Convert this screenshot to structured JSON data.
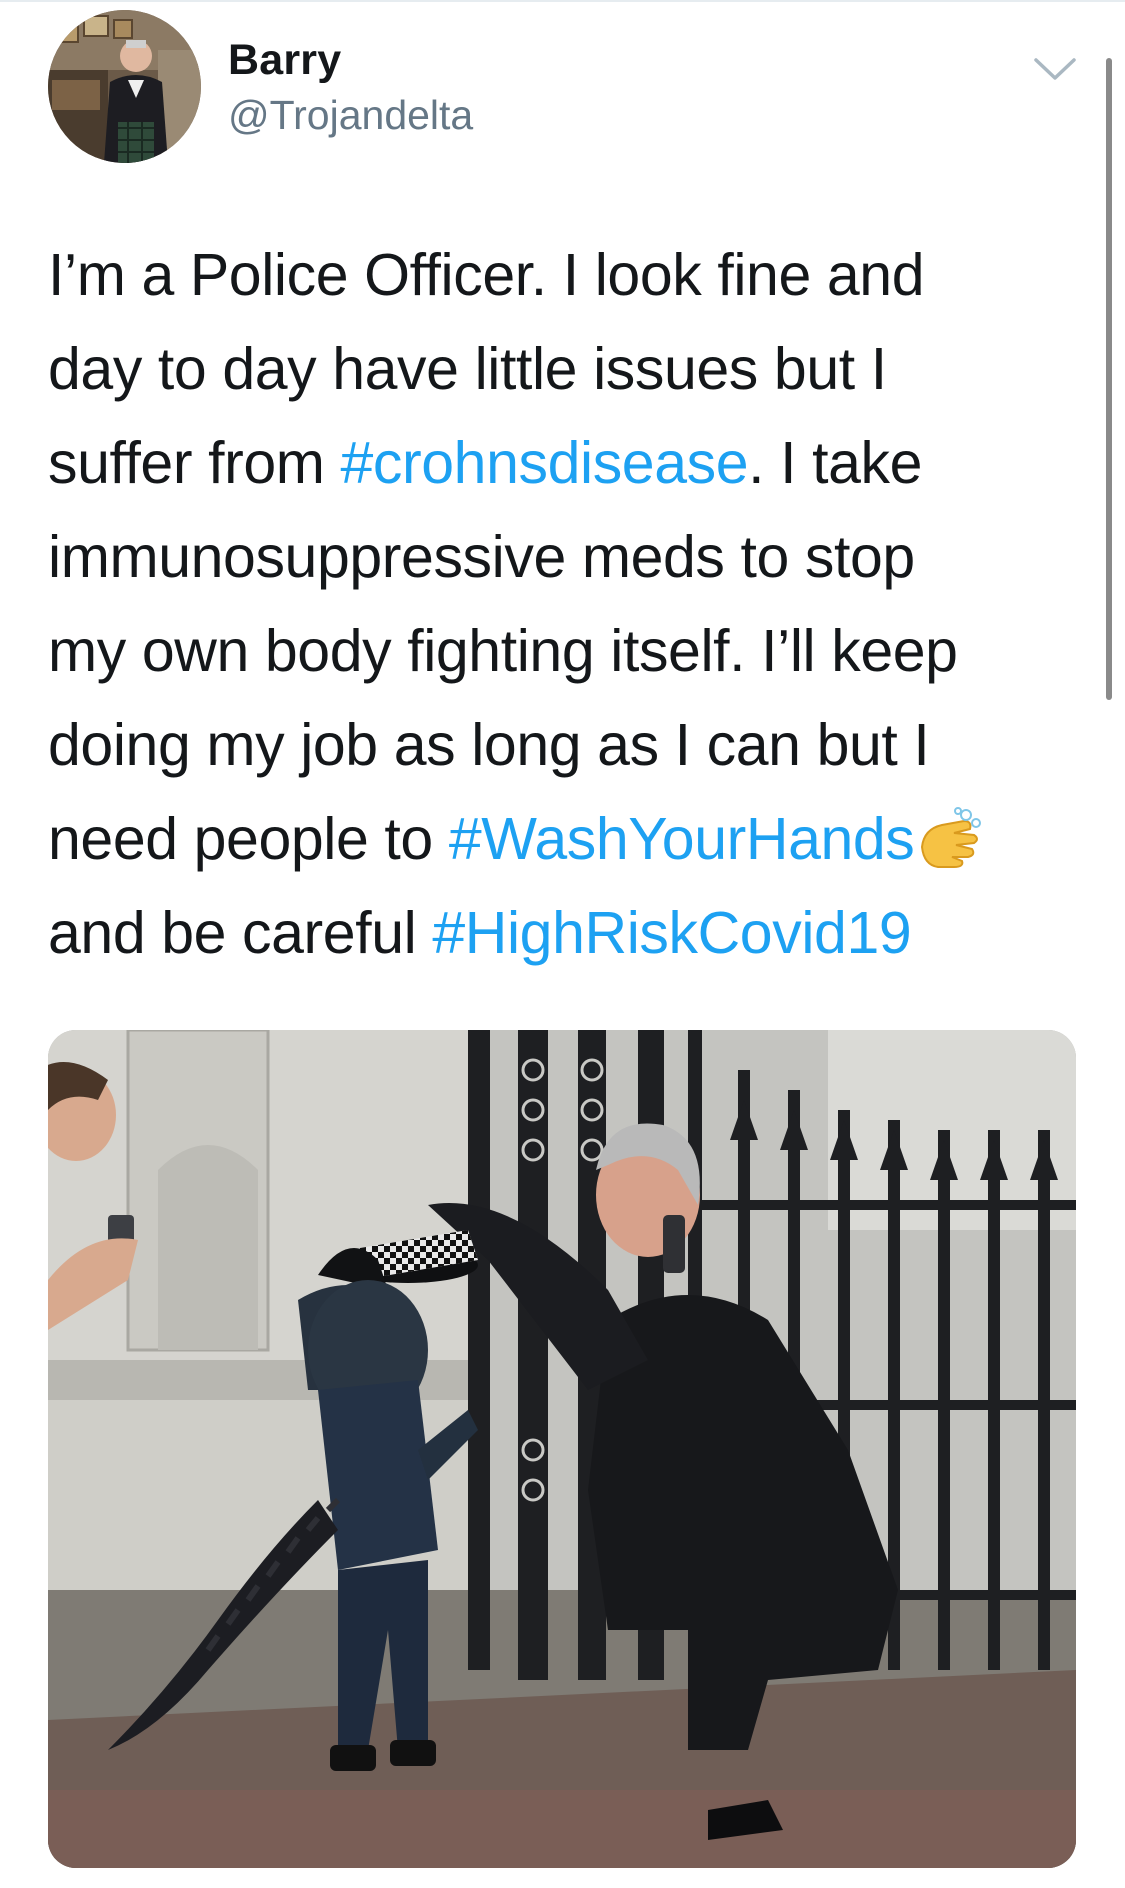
{
  "user": {
    "name": "Barry",
    "handle": "@Trojandelta",
    "avatar_icon": "profile-photo"
  },
  "menu_icon": "chevron-down-icon",
  "tweet": {
    "lines": [
      [
        {
          "t": "I’m a Police Officer. I look fine and"
        }
      ],
      [
        {
          "t": "day to day have little issues but I"
        }
      ],
      [
        {
          "t": "suffer from "
        },
        {
          "t": "#crohnsdisease",
          "tag": true
        },
        {
          "t": ". I take"
        }
      ],
      [
        {
          "t": "immunosuppressive meds to stop"
        }
      ],
      [
        {
          "t": "my own body fighting itself. I’ll keep"
        }
      ],
      [
        {
          "t": "doing my job as long as I can but I"
        }
      ],
      [
        {
          "t": "need people to "
        },
        {
          "t": "#WashYourHands",
          "tag": true
        },
        {
          "emoji": "washing-hands-emoji"
        }
      ],
      [
        {
          "t": "and be careful "
        },
        {
          "t": "#HighRiskCovid19",
          "tag": true
        }
      ]
    ]
  },
  "media": {
    "type": "photo",
    "subject": "police officer placing hat on child in dinosaur costume"
  },
  "colors": {
    "text": "#14171a",
    "secondary": "#657786",
    "link": "#1da1f2"
  }
}
